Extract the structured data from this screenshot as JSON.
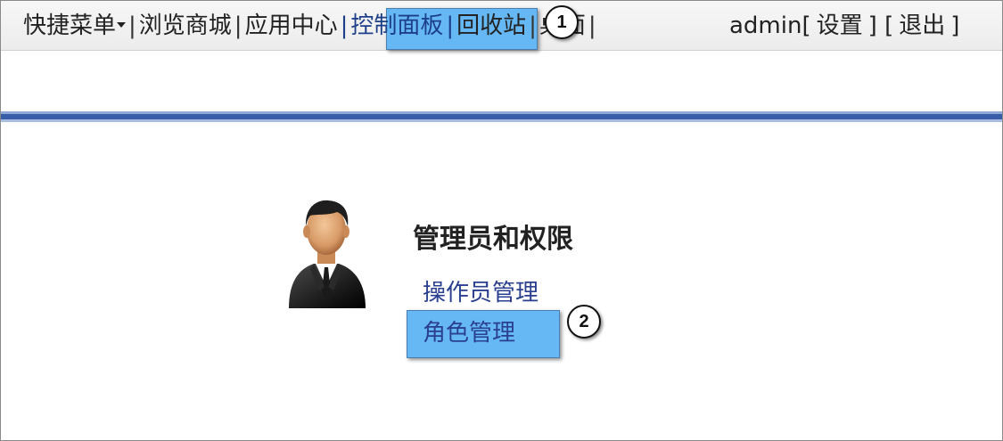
{
  "topnav": {
    "shortcut_menu": "快捷菜单",
    "sep": "|",
    "items": [
      "浏览商城",
      "应用中心",
      "控制面板",
      "回收站",
      "桌面"
    ],
    "user": "admin",
    "bracket_open": "[",
    "bracket_close": "]",
    "settings": "设置",
    "logout": "退出"
  },
  "section": {
    "title": "管理员和权限",
    "links": [
      "操作员管理",
      "角色管理"
    ]
  },
  "callouts": [
    "1",
    "2"
  ],
  "colors": {
    "highlight": "#66b8f5",
    "link": "#2a3f8f",
    "band": "#3a5da8"
  },
  "icons": {
    "avatar": "admin-person-icon",
    "dropdown": "caret-down-icon"
  }
}
